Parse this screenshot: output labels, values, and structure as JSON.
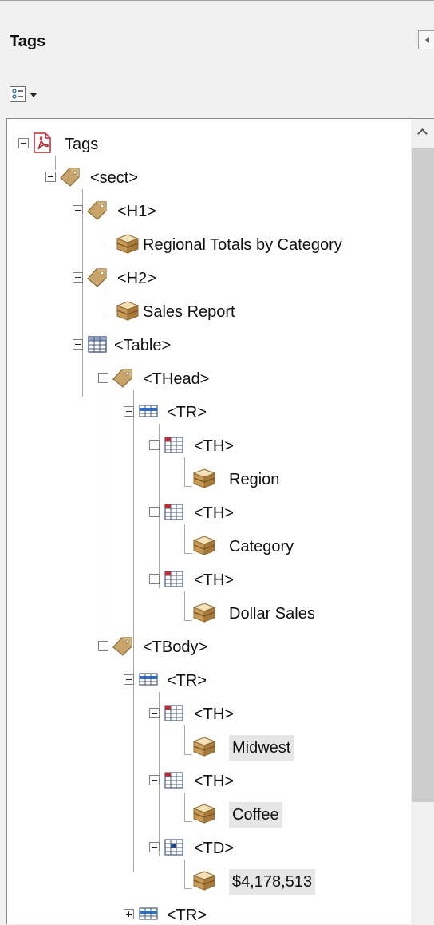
{
  "panel": {
    "title": "Tags"
  },
  "toolbar": {
    "options_icon": "options-menu-icon"
  },
  "icons": {
    "pdf": "pdf-icon",
    "tag": "tag-icon",
    "content": "content-box-icon",
    "table": "table-icon",
    "table_row": "table-row-icon",
    "table_header_cell": "table-header-cell-icon",
    "table_data_cell": "table-data-cell-icon"
  },
  "tree": {
    "root": "Tags",
    "nodes": [
      {
        "label": "<sect>"
      },
      {
        "label": "<H1>"
      },
      {
        "label": "Regional Totals by Category"
      },
      {
        "label": "<H2>"
      },
      {
        "label": "Sales Report"
      },
      {
        "label": "<Table>"
      },
      {
        "label": "<THead>"
      },
      {
        "label": "<TR>"
      },
      {
        "label": "<TH>"
      },
      {
        "label": "Region"
      },
      {
        "label": "<TH>"
      },
      {
        "label": "Category"
      },
      {
        "label": "<TH>"
      },
      {
        "label": "Dollar Sales"
      },
      {
        "label": "<TBody>"
      },
      {
        "label": "<TR>"
      },
      {
        "label": "<TH>"
      },
      {
        "label": "Midwest"
      },
      {
        "label": "<TH>"
      },
      {
        "label": "Coffee"
      },
      {
        "label": "<TD>"
      },
      {
        "label": "$4,178,513"
      },
      {
        "label": "<TR>"
      }
    ]
  }
}
